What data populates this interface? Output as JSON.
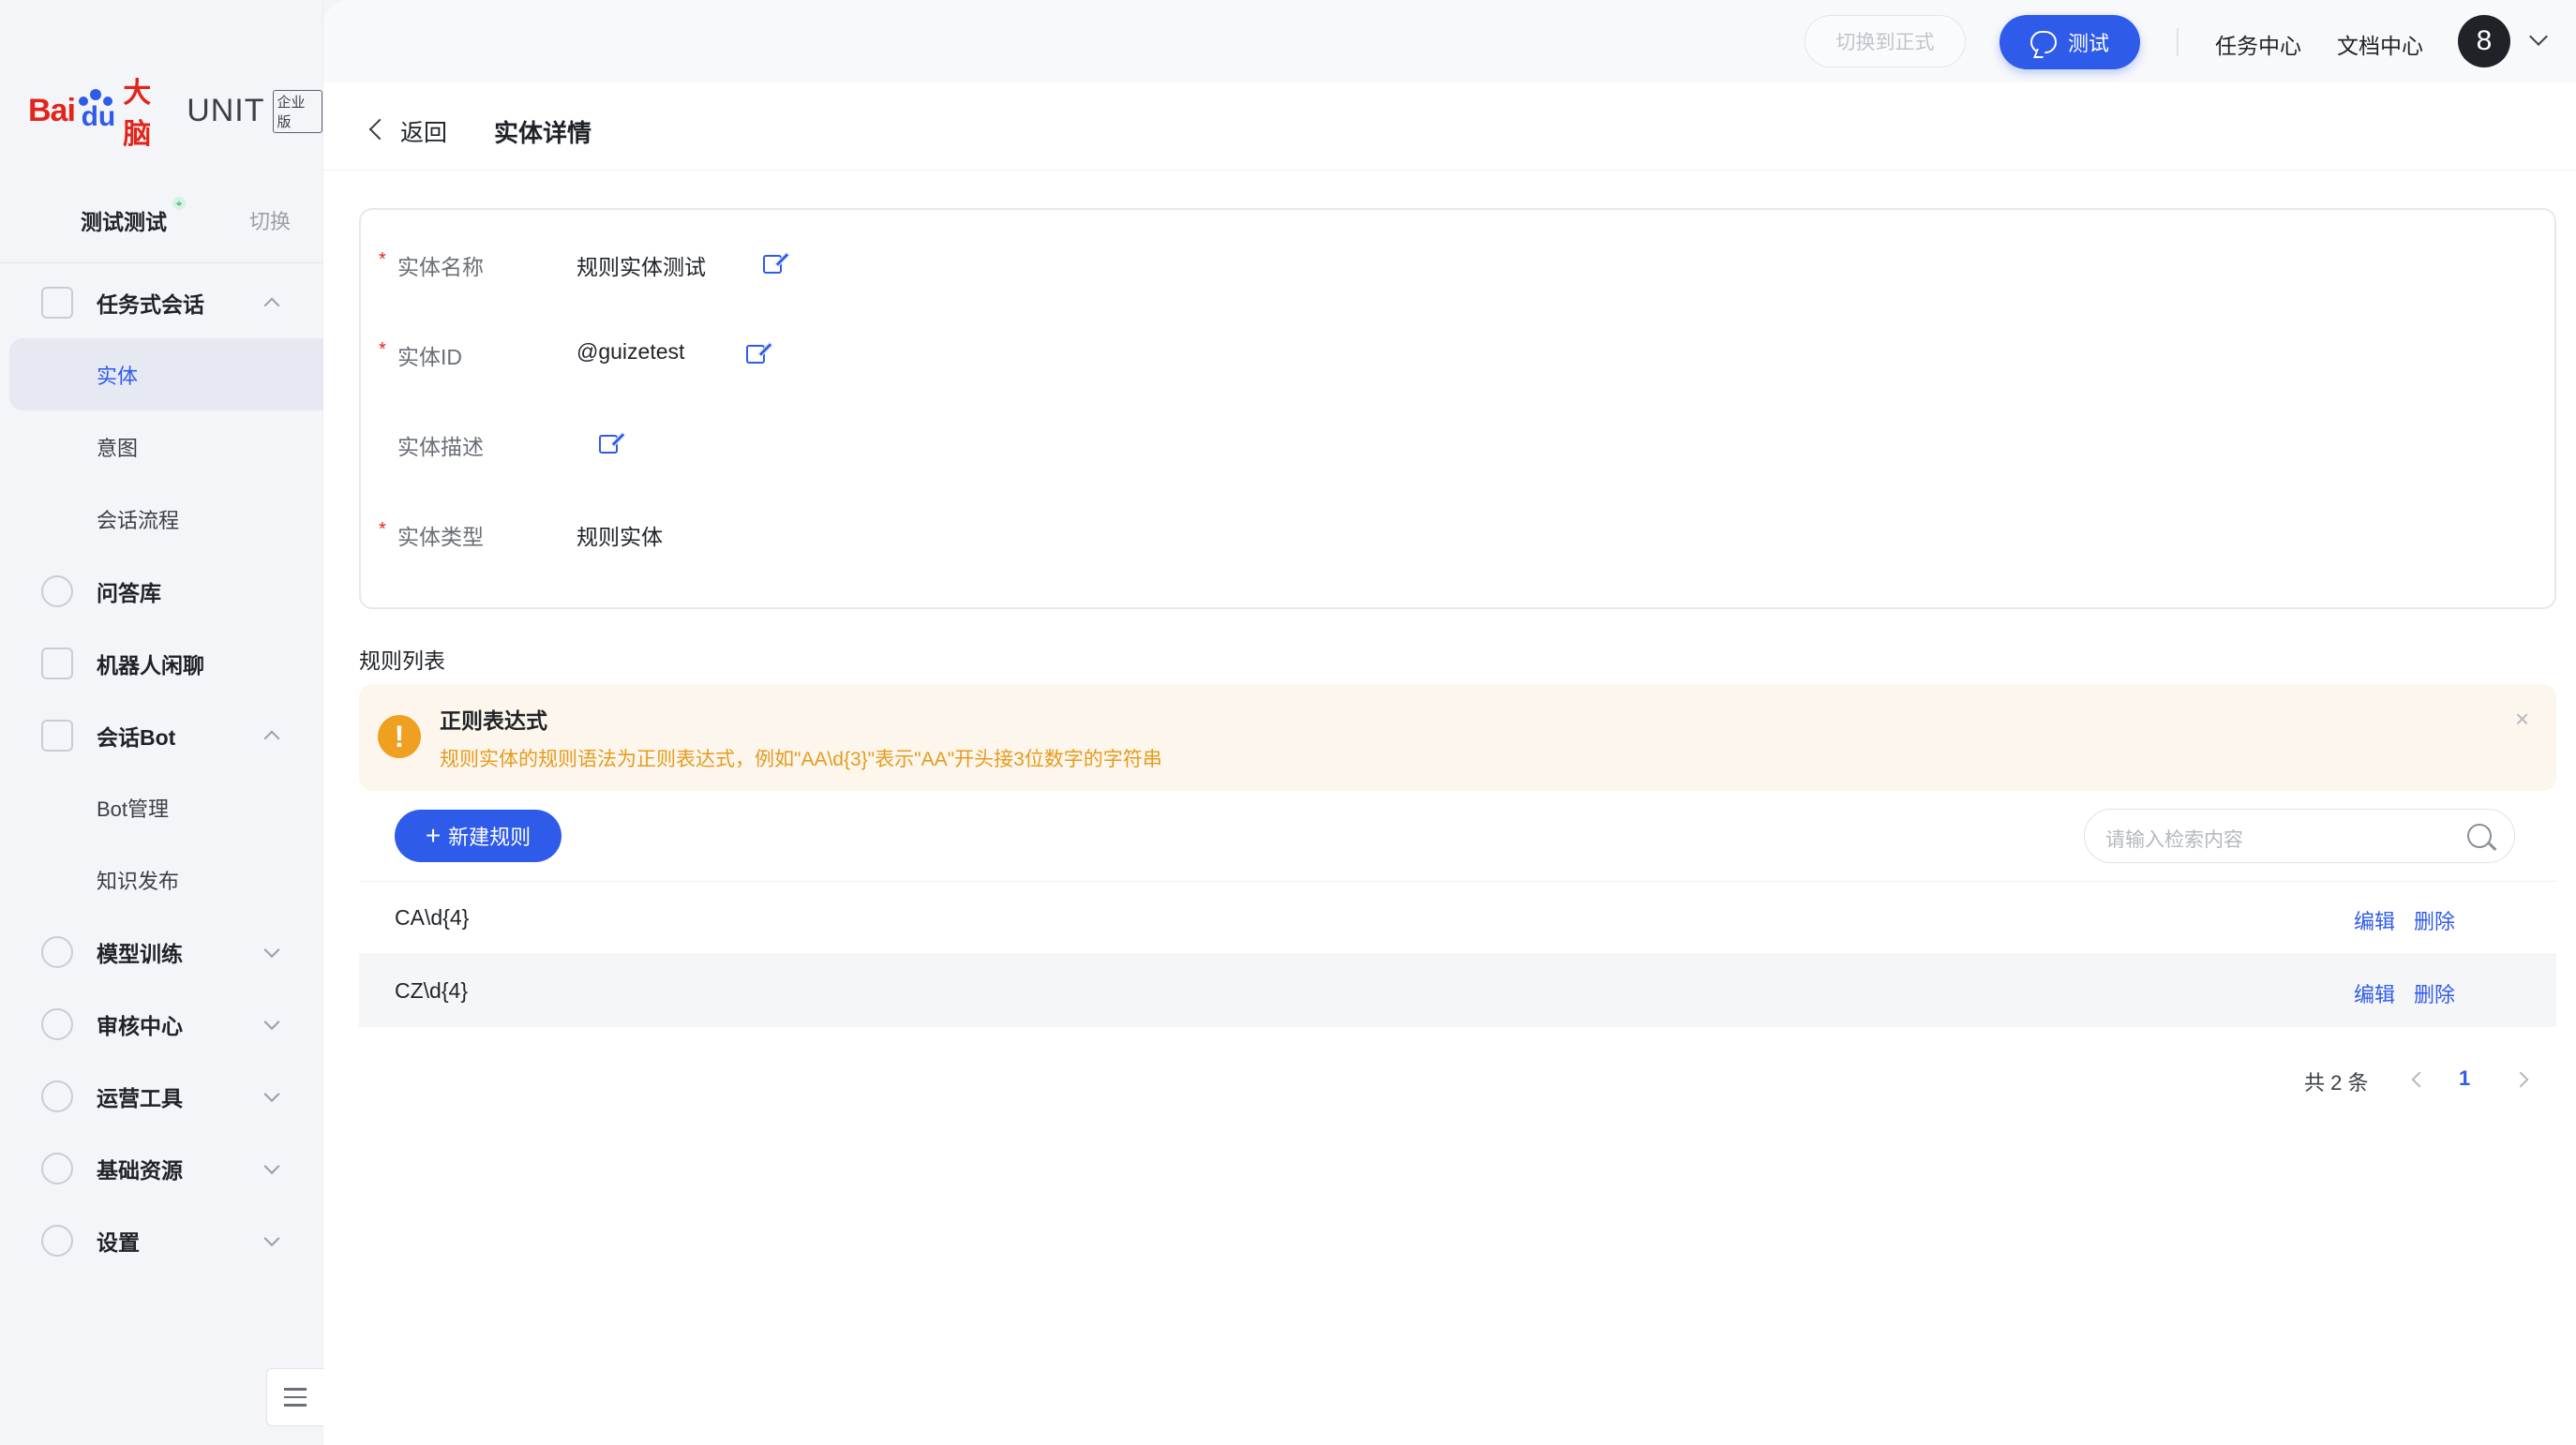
{
  "brand": {
    "bai": "Bai",
    "du": "du",
    "danao": "大脑",
    "unit": "UNIT",
    "edition": "企业版"
  },
  "workspace": {
    "name": "测试测试",
    "pin": "⌖",
    "switch_label": "切换"
  },
  "sidebar": {
    "task_dialog": {
      "label": "任务式会话",
      "icon": "tree-icon"
    },
    "sub_entity": "实体",
    "sub_intent": "意图",
    "sub_flow": "会话流程",
    "qa": {
      "label": "问答库",
      "icon": "question-icon"
    },
    "chat": {
      "label": "机器人闲聊",
      "icon": "chat-icon"
    },
    "bot": {
      "label": "会话Bot",
      "icon": "robot-icon"
    },
    "sub_bot_manage": "Bot管理",
    "sub_knowledge": "知识发布",
    "model": {
      "label": "模型训练",
      "icon": "model-icon"
    },
    "audit": {
      "label": "审核中心",
      "icon": "shield-icon"
    },
    "ops": {
      "label": "运营工具",
      "icon": "tools-icon"
    },
    "resource": {
      "label": "基础资源",
      "icon": "resource-icon"
    },
    "settings": {
      "label": "设置",
      "icon": "gear-icon"
    }
  },
  "topbar": {
    "switch_formal": "切换到正式",
    "test": "测试",
    "task_center": "任务中心",
    "doc_center": "文档中心",
    "avatar": "8"
  },
  "header": {
    "back": "返回",
    "title": "实体详情"
  },
  "entity": {
    "name_label": "实体名称",
    "name_value": "规则实体测试",
    "id_label": "实体ID",
    "id_value": "@guizetest",
    "desc_label": "实体描述",
    "desc_value": "",
    "type_label": "实体类型",
    "type_value": "规则实体",
    "required_mark": "*"
  },
  "rules": {
    "title": "规则列表",
    "alert_title": "正则表达式",
    "alert_desc": "规则实体的规则语法为正则表达式，例如\"AA\\d{3}\"表示\"AA\"开头接3位数字的字符串",
    "alert_icon": "!",
    "close": "×",
    "new_button": "新建规则",
    "new_plus": "+",
    "search_placeholder": "请输入检索内容",
    "rows": [
      {
        "rule": "CA\\d{4}",
        "edit": "编辑",
        "delete": "删除"
      },
      {
        "rule": "CZ\\d{4}",
        "edit": "编辑",
        "delete": "删除"
      }
    ]
  },
  "pagination": {
    "total": "共 2 条",
    "current": "1"
  },
  "colors": {
    "accent": "#2f5bea",
    "warning": "#f0a020",
    "danger": "#e0261c"
  }
}
